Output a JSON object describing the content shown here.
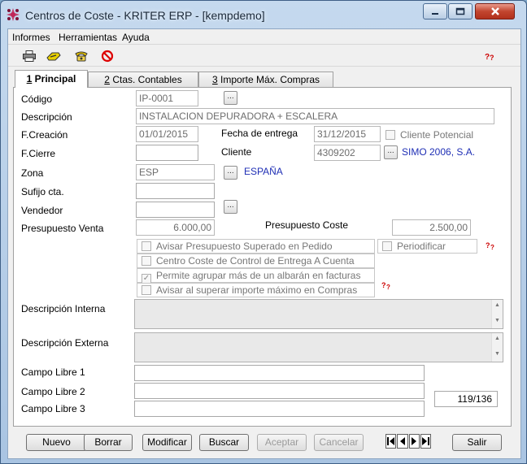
{
  "window": {
    "title": "Centros de Coste - KRITER ERP - [kempdemo]"
  },
  "menu": {
    "items": [
      "Informes",
      "Herramientas",
      "Ayuda"
    ]
  },
  "toolbar": {
    "icons": [
      "printer-icon",
      "key-icon",
      "phone-icon",
      "cancel-icon",
      "help-icon"
    ]
  },
  "tabs": [
    {
      "num": "1",
      "label": " Principal"
    },
    {
      "num": "2",
      "label": " Ctas. Contables"
    },
    {
      "num": "3",
      "label": " Importe Máx. Compras"
    }
  ],
  "form": {
    "codigo_label": "Código",
    "codigo": "IP-0001",
    "descripcion_label": "Descripción",
    "descripcion": "INSTALACION DEPURADORA + ESCALERA",
    "fcreacion_label": "F.Creación",
    "fcreacion": "01/01/2015",
    "fentrega_label": "Fecha de entrega",
    "fentrega": "31/12/2015",
    "cliente_potencial_label": "Cliente Potencial",
    "fcierre_label": "F.Cierre",
    "fcierre": "",
    "cliente_label": "Cliente",
    "cliente": "4309202",
    "cliente_nombre": "SIMO 2006, S.A.",
    "zona_label": "Zona",
    "zona": "ESP",
    "zona_nombre": "ESPAÑA",
    "sufijo_label": "Sufijo cta.",
    "sufijo": "",
    "vendedor_label": "Vendedor",
    "vendedor": "",
    "ppto_venta_label": "Presupuesto Venta",
    "ppto_venta": "6.000,00",
    "ppto_coste_label": "Presupuesto Coste",
    "ppto_coste": "2.500,00",
    "chk_avisar_label": "Avisar Presupuesto Superado en Pedido",
    "chk_periodificar_label": "Periodificar",
    "chk_centro_label": "Centro Coste de Control de Entrega A Cuenta",
    "chk_agrupar_label": "Permite agrupar más de un albarán en facturas",
    "chk_avisar_max_label": "Avisar al superar importe máximo en Compras",
    "desc_interna_label": "Descripción Interna",
    "desc_externa_label": "Descripción Externa",
    "campo1_label": "Campo Libre 1",
    "campo2_label": "Campo Libre 2",
    "campo3_label": "Campo Libre 3",
    "record_counter": "119/136"
  },
  "buttons": {
    "nuevo": "Nuevo",
    "borrar": "Borrar",
    "modificar": "Modificar",
    "buscar": "Buscar",
    "aceptar": "Aceptar",
    "cancelar": "Cancelar",
    "salir": "Salir"
  }
}
